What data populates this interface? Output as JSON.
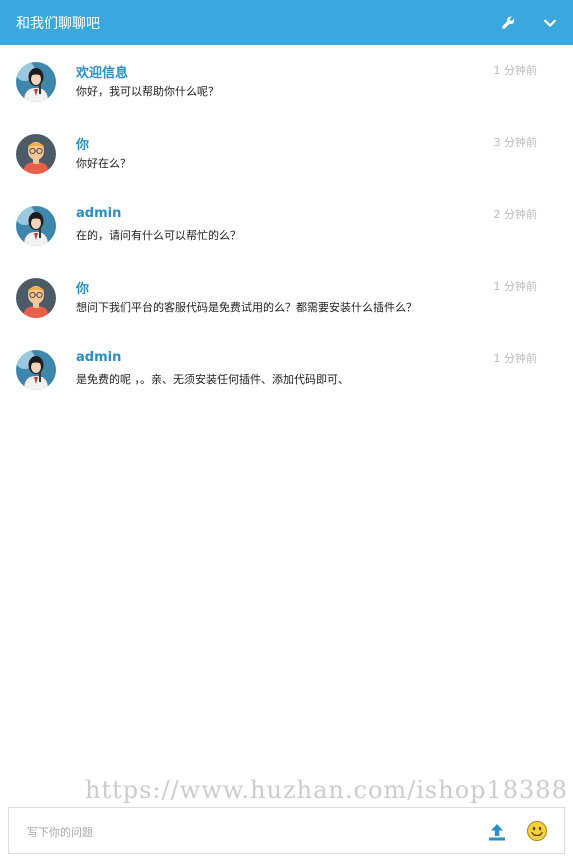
{
  "header": {
    "title": "和我们聊聊吧",
    "settings_icon": "wrench-icon",
    "collapse_icon": "chevron-down-icon",
    "background": "#3aa7de"
  },
  "messages": [
    {
      "name": "欢迎信息",
      "time": "1 分钟前",
      "text": "你好，我可以帮助你什么呢？",
      "avatar": "agent-avatar"
    },
    {
      "name": "你",
      "time": "3 分钟前",
      "text": "你好在么？",
      "avatar": "user-avatar"
    },
    {
      "name": "admin",
      "time": "2 分钟前",
      "text": "在的，请问有什么可以帮忙的么？",
      "avatar": "agent-avatar"
    },
    {
      "name": "你",
      "time": "1 分钟前",
      "text": "想问下我们平台的客服代码是免费试用的么？都需要安装什么插件么？",
      "avatar": "user-avatar"
    },
    {
      "name": "admin",
      "time": "1 分钟前",
      "text": "是免费的呢 ，。亲、无须安装任何插件、添加代码即可、",
      "avatar": "agent-avatar"
    }
  ],
  "watermark": "https://www.huzhan.com/ishop18388",
  "composer": {
    "placeholder": "写下你的问题",
    "value": "",
    "upload_icon": "upload-icon",
    "emoji_icon": "emoji-icon"
  },
  "colors": {
    "accent": "#3aa7de",
    "name_color": "#2a8fc6",
    "time_color": "#bbbbbb"
  }
}
